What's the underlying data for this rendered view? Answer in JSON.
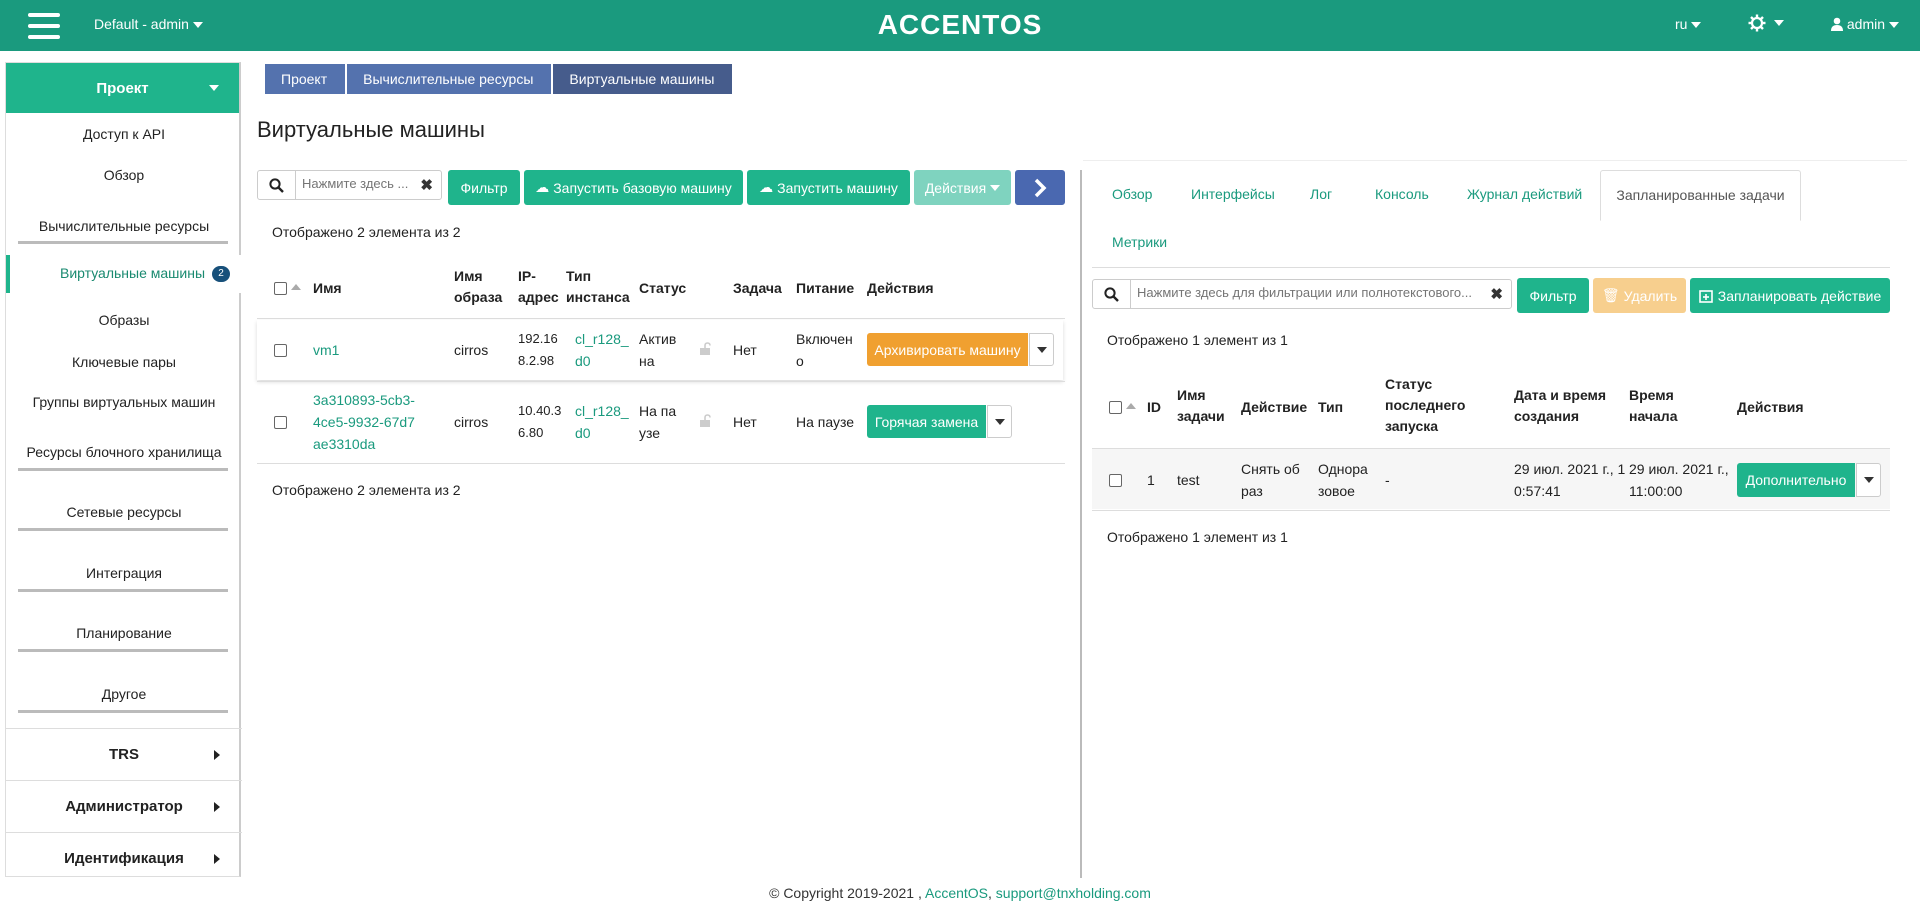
{
  "topbar": {
    "project": "Default - admin",
    "logo": "ACCENTOS",
    "lang": "ru",
    "user": "admin"
  },
  "sidebar": {
    "project_label": "Проект",
    "items": [
      "Доступ к API",
      "Обзор",
      "Вычислительные ресурсы",
      "Виртуальные машины",
      "Образы",
      "Ключевые пары",
      "Группы виртуальных машин",
      "Ресурсы блочного хранилища",
      "Сетевые ресурсы",
      "Интеграция",
      "Планирование",
      "Другое"
    ],
    "vm_badge": "2",
    "sections": [
      "TRS",
      "Администратор",
      "Идентификация"
    ]
  },
  "breadcrumb": [
    "Проект",
    "Вычислительные ресурсы",
    "Виртуальные машины"
  ],
  "page_title": "Виртуальные машины",
  "left": {
    "search_placeholder": "Нажмите здесь ...",
    "filter": "Фильтр",
    "launch_base": "Запустить базовую машину",
    "launch": "Запустить машину",
    "actions": "Действия",
    "count_top": "Отображено 2 элемента из 2",
    "count_bottom": "Отображено 2 элемента из 2",
    "headers": {
      "name": "Имя",
      "image": [
        "Имя",
        "образа"
      ],
      "ip": [
        "IP-",
        "адрес"
      ],
      "type": [
        "Тип",
        "инстанса"
      ],
      "status": "Статус",
      "task": "Задача",
      "power": "Питание",
      "actions": "Действия"
    },
    "rows": [
      {
        "name": [
          "vm1"
        ],
        "image": "cirros",
        "ip": [
          "192.16",
          "8.2.98"
        ],
        "type": [
          "cl_r128_",
          "d0"
        ],
        "status": [
          "Актив",
          "на"
        ],
        "task": "Нет",
        "power": [
          "Включен",
          "о"
        ],
        "action": "Архивировать машину",
        "action_color": "#f0a030"
      },
      {
        "name": [
          "3a310893-5cb3-",
          "4ce5-9932-67d7",
          "ae3310da"
        ],
        "image": "cirros",
        "ip": [
          "10.40.3",
          "6.80"
        ],
        "type": [
          "cl_r128_",
          "d0"
        ],
        "status": [
          "На па",
          "узе"
        ],
        "task": "Нет",
        "power": [
          "На паузе"
        ],
        "action": "Горячая замена",
        "action_color": "#1fb48c"
      }
    ]
  },
  "right": {
    "tabs": [
      "Обзор",
      "Интерфейсы",
      "Лог",
      "Консоль",
      "Журнал действий",
      "Запланированные задачи",
      "Метрики"
    ],
    "search_placeholder": "Нажмите здесь для фильтрации или полнотекстового...",
    "filter": "Фильтр",
    "delete": "Удалить",
    "schedule": "Запланировать действие",
    "count_top": "Отображено 1 элемент из 1",
    "count_bottom": "Отображено 1 элемент из 1",
    "headers": {
      "id": "ID",
      "name": [
        "Имя",
        "задачи"
      ],
      "action": "Действие",
      "type": "Тип",
      "status": [
        "Статус",
        "последнего",
        "запуска"
      ],
      "created": [
        "Дата и время",
        "создания"
      ],
      "start": [
        "Время",
        "начала"
      ],
      "actions": "Действия"
    },
    "row": {
      "id": "1",
      "name": "test",
      "action": [
        "Снять об",
        "раз"
      ],
      "type": [
        "Однора",
        "зовое"
      ],
      "status": "-",
      "created": [
        "29 июл. 2021 г., 1",
        "0:57:41"
      ],
      "start": [
        "29 июл. 2021 г.,",
        "11:00:00"
      ],
      "button": "Дополнительно"
    }
  },
  "footer": {
    "copyright": "© Copyright 2019-2021 ,",
    "brand": "AccentOS",
    "sep": ",",
    "email": "support@tnxholding.com"
  }
}
